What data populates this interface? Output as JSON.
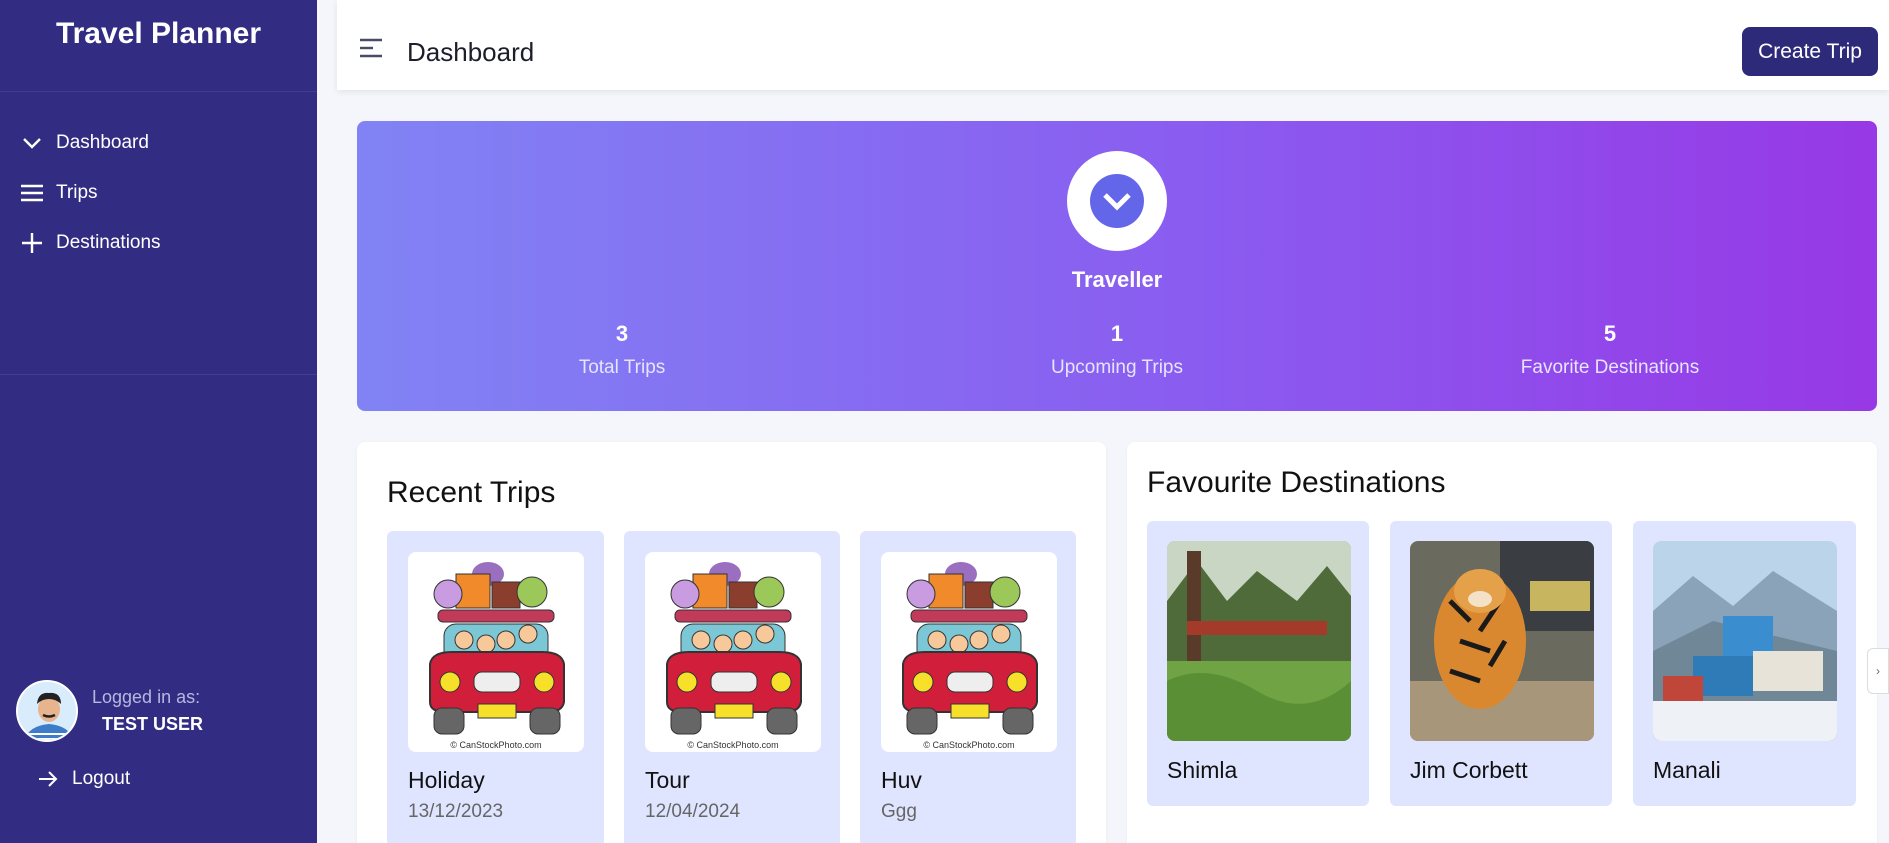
{
  "sidebar": {
    "brand": "Travel Planner",
    "items": [
      {
        "label": "Dashboard",
        "icon": "chevron-down-icon"
      },
      {
        "label": "Trips",
        "icon": "list-icon"
      },
      {
        "label": "Destinations",
        "icon": "plus-icon"
      }
    ],
    "user": {
      "label": "Logged in as:",
      "name": "TEST USER"
    },
    "logout": "Logout"
  },
  "header": {
    "title": "Dashboard",
    "create_button": "Create Trip"
  },
  "hero": {
    "name": "Traveller",
    "stats": [
      {
        "value": "3",
        "label": "Total Trips"
      },
      {
        "value": "1",
        "label": "Upcoming Trips"
      },
      {
        "value": "5",
        "label": "Favorite Destinations"
      }
    ]
  },
  "recent": {
    "title": "Recent Trips",
    "trips": [
      {
        "title": "Holiday",
        "sub": "13/12/2023",
        "caption": "© CanStockPhoto.com"
      },
      {
        "title": "Tour",
        "sub": "12/04/2024",
        "caption": "© CanStockPhoto.com"
      },
      {
        "title": "Huv",
        "sub": "Ggg",
        "caption": "© CanStockPhoto.com"
      }
    ]
  },
  "favourites": {
    "title": "Favourite Destinations",
    "items": [
      {
        "name": "Shimla"
      },
      {
        "name": "Jim Corbett"
      },
      {
        "name": "Manali"
      }
    ]
  },
  "colors": {
    "sidebar": "#322d83",
    "accent": "#2d2a7a",
    "hero_start": "#8183f4",
    "hero_end": "#9739e6",
    "card": "#e0e5ff"
  }
}
